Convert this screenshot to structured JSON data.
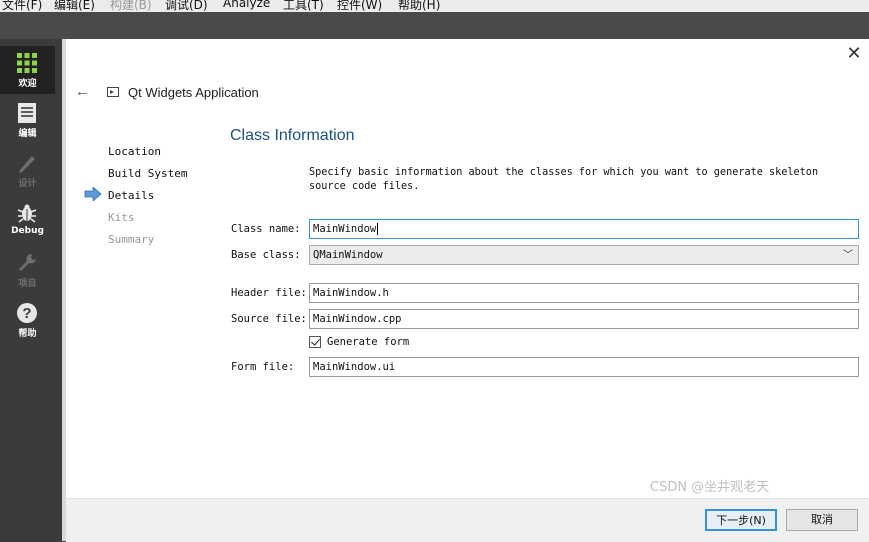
{
  "menubar": {
    "items": [
      {
        "label": "文件(F)",
        "enabled": true
      },
      {
        "label": "编辑(E)",
        "enabled": true
      },
      {
        "label": "构建(B)",
        "enabled": false
      },
      {
        "label": "调试(D)",
        "enabled": true
      },
      {
        "label": "Analyze",
        "enabled": true
      },
      {
        "label": "工具(T)",
        "enabled": true
      },
      {
        "label": "控件(W)",
        "enabled": true
      },
      {
        "label": "帮助(H)",
        "enabled": true
      }
    ]
  },
  "modebar": {
    "items": [
      {
        "label": "欢迎",
        "icon": "grid-icon",
        "active": true,
        "enabled": true
      },
      {
        "label": "编辑",
        "icon": "document-icon",
        "active": false,
        "enabled": true
      },
      {
        "label": "设计",
        "icon": "pencil-icon",
        "active": false,
        "enabled": false
      },
      {
        "label": "Debug",
        "icon": "bug-icon",
        "active": false,
        "enabled": true
      },
      {
        "label": "项目",
        "icon": "wrench-icon",
        "active": false,
        "enabled": false
      },
      {
        "label": "帮助",
        "icon": "help-icon",
        "active": false,
        "enabled": true
      }
    ]
  },
  "wizard": {
    "title": "Qt Widgets Application",
    "steps": [
      {
        "label": "Location",
        "state": "done"
      },
      {
        "label": "Build System",
        "state": "done"
      },
      {
        "label": "Details",
        "state": "current"
      },
      {
        "label": "Kits",
        "state": "pending"
      },
      {
        "label": "Summary",
        "state": "pending"
      }
    ],
    "page_title": "Class Information",
    "description": "Specify basic information about the classes for which you want to generate skeleton source code files.",
    "fields": {
      "class_name": {
        "label": "Class name:",
        "value": "MainWindow"
      },
      "base_class": {
        "label": "Base class:",
        "value": "QMainWindow"
      },
      "header_file": {
        "label": "Header file:",
        "value": "MainWindow.h"
      },
      "source_file": {
        "label": "Source file:",
        "value": "MainWindow.cpp"
      },
      "generate_form": {
        "label": "Generate form",
        "checked": true
      },
      "form_file": {
        "label": "Form file:",
        "value": "MainWindow.ui"
      }
    },
    "buttons": {
      "next": "下一步(N)",
      "cancel": "取消"
    }
  },
  "watermark": "CSDN @坐井观老天",
  "colors": {
    "accent": "#3b8fd6",
    "title": "#1f4f82",
    "modebar_bg": "#3b3b3b"
  }
}
